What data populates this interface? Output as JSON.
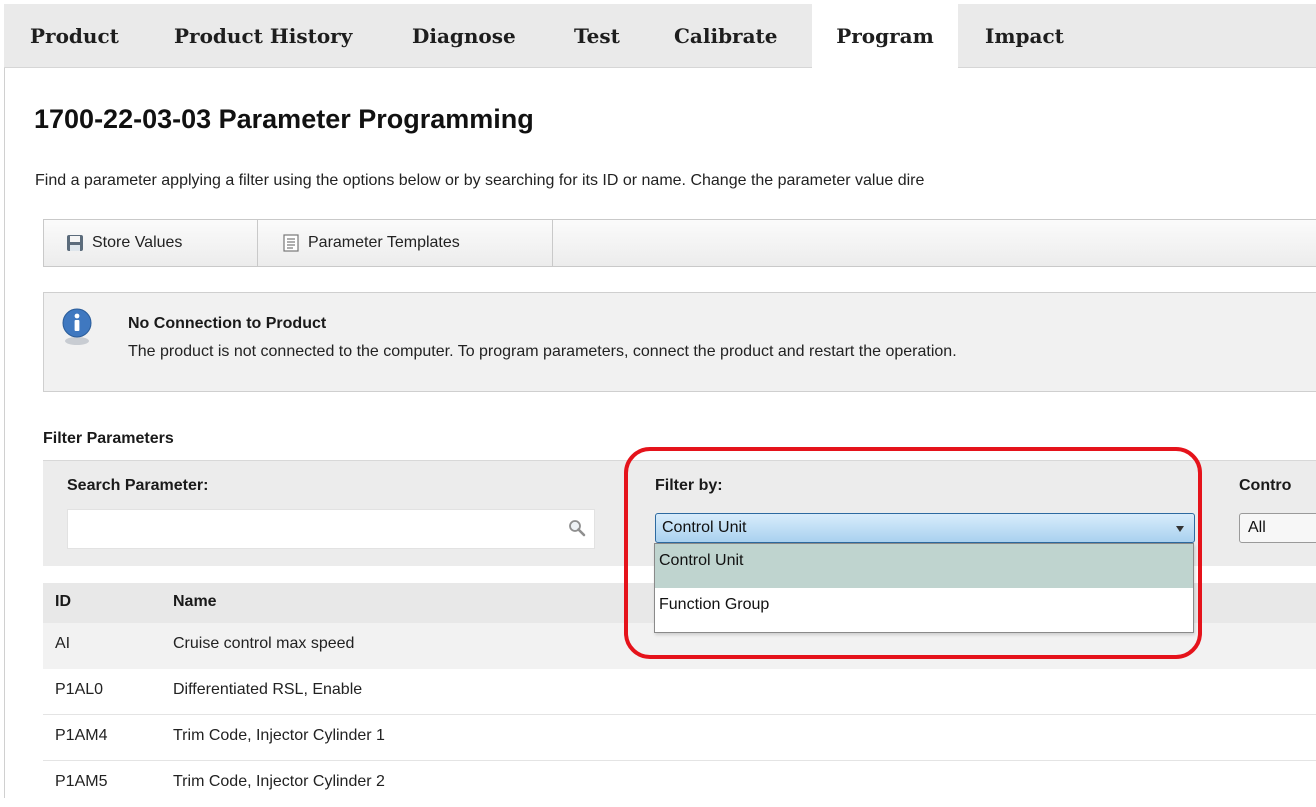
{
  "nav": {
    "tabs": [
      {
        "label": "Product"
      },
      {
        "label": "Product History"
      },
      {
        "label": "Diagnose"
      },
      {
        "label": "Test"
      },
      {
        "label": "Calibrate"
      },
      {
        "label": "Program"
      },
      {
        "label": "Impact"
      }
    ],
    "active_tab": "Program"
  },
  "page": {
    "title": "1700-22-03-03 Parameter Programming",
    "intro": "Find a parameter applying a filter using the options below or by searching for its ID or name. Change the parameter value dire"
  },
  "toolbar": {
    "store_values_label": "Store Values",
    "store_values_icon": "floppy-disk-icon",
    "parameter_templates_label": "Parameter Templates",
    "parameter_templates_icon": "document-list-icon"
  },
  "info": {
    "icon": "info-icon",
    "title": "No Connection to Product",
    "text": "The product is not connected to the computer. To program parameters, connect the product and restart the operation."
  },
  "filter": {
    "heading": "Filter Parameters",
    "search_label": "Search Parameter:",
    "search_value": "",
    "filter_by_label": "Filter by:",
    "filter_by_selected": "Control Unit",
    "filter_by_options": [
      "Control Unit",
      "Function Group"
    ],
    "control_label": "Contro",
    "control_selected": "All"
  },
  "table": {
    "columns": [
      "ID",
      "Name"
    ],
    "rows": [
      {
        "id": "AI",
        "name": "Cruise control max speed"
      },
      {
        "id": "P1AL0",
        "name": "Differentiated RSL, Enable"
      },
      {
        "id": "P1AM4",
        "name": "Trim Code, Injector Cylinder 1"
      },
      {
        "id": "P1AM5",
        "name": "Trim Code, Injector Cylinder 2"
      }
    ]
  },
  "colors": {
    "highlight": "#e5131b",
    "selected_option": "#bfd4cf",
    "select_active": "#a9d1ef"
  }
}
